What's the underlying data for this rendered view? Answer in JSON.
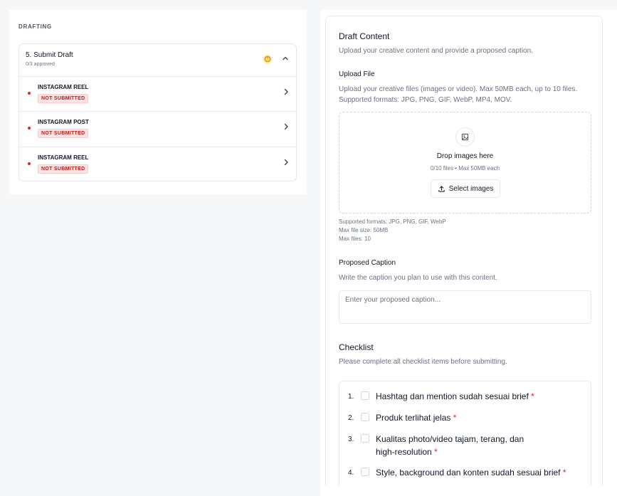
{
  "left": {
    "section_label": "DRAFTING",
    "step": {
      "title": "5. Submit Draft",
      "subtitle": "0/3 approved"
    },
    "items": [
      {
        "title": "INSTAGRAM REEL",
        "status": "NOT SUBMITTED"
      },
      {
        "title": "INSTAGRAM POST",
        "status": "NOT SUBMITTED"
      },
      {
        "title": "INSTAGRAM REEL",
        "status": "NOT SUBMITTED"
      }
    ]
  },
  "right": {
    "title": "Draft Content",
    "description": "Upload your creative content and provide a proposed caption.",
    "upload": {
      "label": "Upload File",
      "description": "Upload your creative files (images or video). Max 50MB each, up to 10 files. Supported formats: JPG, PNG, GIF, WebP, MP4, MOV.",
      "drop_title": "Drop images here",
      "drop_sub": "0/10 files • Max 50MB each",
      "select_label": "Select images",
      "meta": [
        {
          "label": "Supported formats:",
          "value": "JPG, PNG, GIF, WebP"
        },
        {
          "label": "Max file size:",
          "value": "50MB"
        },
        {
          "label": "Max files:",
          "value": "10"
        }
      ]
    },
    "caption": {
      "label": "Proposed Caption",
      "description": "Write the caption you plan to use with this content.",
      "placeholder": "Enter your proposed caption..."
    },
    "checklist": {
      "title": "Checklist",
      "description": "Please complete all checklist items before submitting.",
      "items": [
        {
          "num": "1.",
          "text": "Hashtag dan mention sudah sesuai brief",
          "required": "*"
        },
        {
          "num": "2.",
          "text": "Produk terlihat jelas",
          "required": "*"
        },
        {
          "num": "3.",
          "text": "Kualitas photo/video tajam, terang, dan high-resolution",
          "required": "*"
        },
        {
          "num": "4.",
          "text": "Style, background dan konten sudah sesuai brief",
          "required": "*"
        }
      ]
    }
  },
  "colors": {
    "danger": "#dc2626",
    "warning": "#f59e0b",
    "border": "#e5e7eb",
    "muted_text": "#6b7280"
  }
}
